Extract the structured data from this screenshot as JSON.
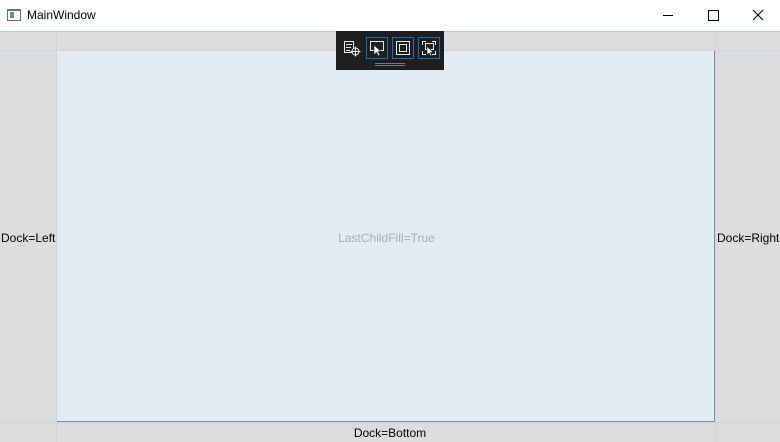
{
  "window": {
    "title": "MainWindow"
  },
  "caption_buttons": {
    "minimize": "minimize-icon",
    "maximize": "maximize-icon",
    "close": "close-icon"
  },
  "debug_toolbar": {
    "buttons": [
      {
        "icon": "live-visual-tree-icon",
        "active": false
      },
      {
        "icon": "select-element-icon",
        "active": true
      },
      {
        "icon": "display-layout-adorners-icon",
        "active": true
      },
      {
        "icon": "track-focus-icon",
        "active": true
      }
    ],
    "accent": "#0e72c7"
  },
  "dock_panel": {
    "left_label": "Dock=Left",
    "right_label": "Dock=Right",
    "bottom_label": "Dock=Bottom",
    "fill_label": "LastChildFill=True",
    "panel_color": "#dcdcdc",
    "fill_color": "#e1ecf3"
  }
}
